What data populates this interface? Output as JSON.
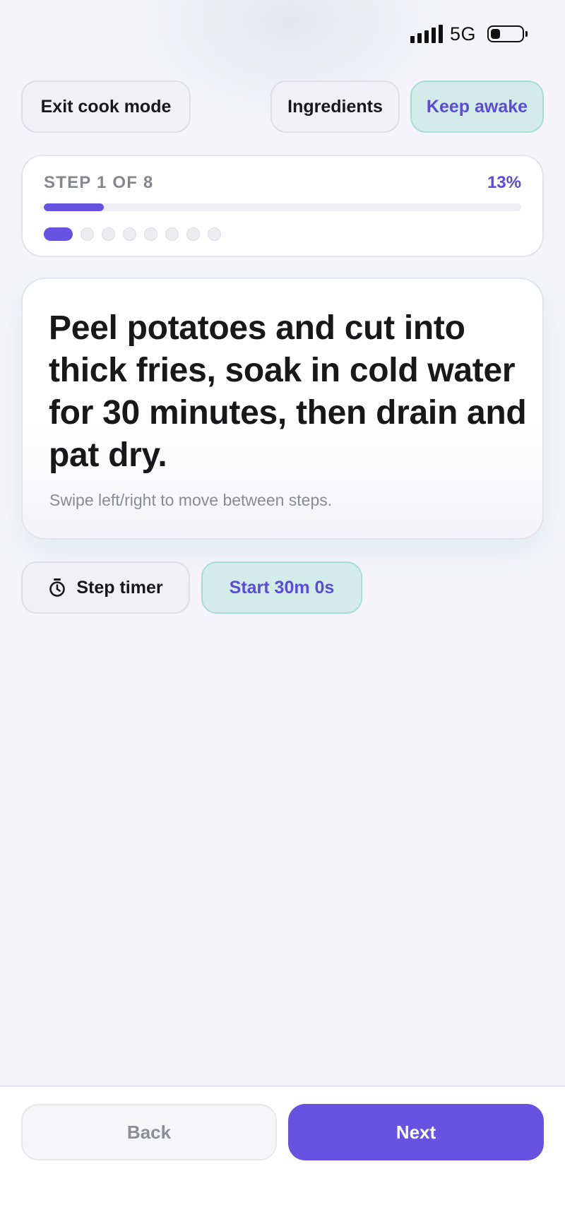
{
  "status_bar": {
    "network": "5G",
    "battery_level": 0.3
  },
  "header": {
    "exit_label": "Exit cook mode",
    "ingredients_label": "Ingredients",
    "keep_awake_label": "Keep awake"
  },
  "progress": {
    "step_label": "STEP 1 OF 8",
    "percent_label": "13%",
    "current_step": 1,
    "total_steps": 8,
    "fraction": 0.125
  },
  "step": {
    "instruction": "Peel potatoes and cut into thick fries, soak in cold water for 30 minutes, then drain and pat dry.",
    "hint": "Swipe left/right to move between steps."
  },
  "timer": {
    "label": "Step timer",
    "start_label": "Start 30m 0s",
    "icon": "stopwatch-icon"
  },
  "navigation": {
    "back_label": "Back",
    "next_label": "Next"
  },
  "colors": {
    "accent": "#6752e2",
    "accent_text": "#5b4bd6",
    "mint_bg": "#d3ece9",
    "background": "#f5f5f9"
  }
}
